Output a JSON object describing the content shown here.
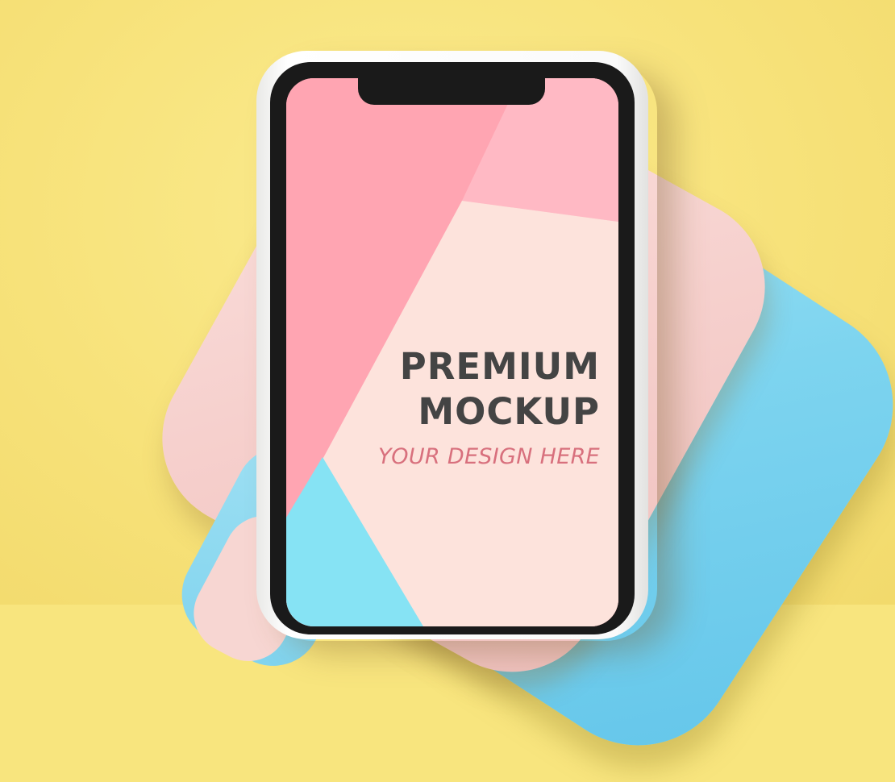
{
  "mockup": {
    "headline_line1": "PREMIUM",
    "headline_line2": "MOCKUP",
    "tagline": "YOUR DESIGN HERE"
  },
  "colors": {
    "background": "#f8e57e",
    "screen_pink": "#ffa5b2",
    "screen_light_pink": "#ffb9c4",
    "screen_peach": "#fde3dc",
    "screen_blue": "#86e3f4",
    "case_pink": "#f6d0cd",
    "case_blue": "#7dd4ef",
    "headline": "#444444",
    "tagline": "#d8707d"
  }
}
